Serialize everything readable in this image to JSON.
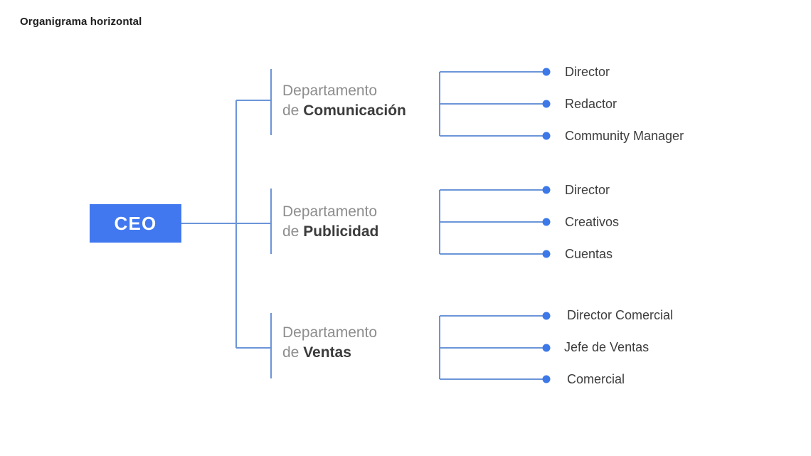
{
  "document": {
    "title": "Organigrama horizontal",
    "background_color": "#ffffff"
  },
  "colors": {
    "node_fill": "#4178ef",
    "node_text": "#ffffff",
    "connector_line": "#6b95d8",
    "connector_dot": "#3d78e8",
    "dept_prefix_text": "#8d8d8d",
    "dept_name_text": "#3b3b3b",
    "leaf_text": "#3d3d3d",
    "title_text": "#1d1d1d"
  },
  "chart_data": {
    "type": "diagram",
    "diagram_type": "organizational-chart-horizontal",
    "title": "Organigrama horizontal",
    "orientation": "horizontal",
    "root": {
      "label": "CEO"
    },
    "departments": [
      {
        "prefix_line1": "Departamento",
        "prefix_line2": "de ",
        "name": "Comunicación",
        "full_label": "Departamento de Comunicación",
        "roles": [
          {
            "label": "Director"
          },
          {
            "label": "Redactor"
          },
          {
            "label": "Community Manager"
          }
        ]
      },
      {
        "prefix_line1": "Departamento",
        "prefix_line2": "de ",
        "name": "Publicidad",
        "full_label": "Departamento de Publicidad",
        "roles": [
          {
            "label": "Director"
          },
          {
            "label": "Creativos"
          },
          {
            "label": "Cuentas"
          }
        ]
      },
      {
        "prefix_line1": "Departamento",
        "prefix_line2": "de ",
        "name": "Ventas",
        "full_label": "Departamento de Ventas",
        "roles": [
          {
            "label": "Director Comercial"
          },
          {
            "label": "Jefe de Ventas"
          },
          {
            "label": "Comercial"
          }
        ]
      }
    ]
  }
}
